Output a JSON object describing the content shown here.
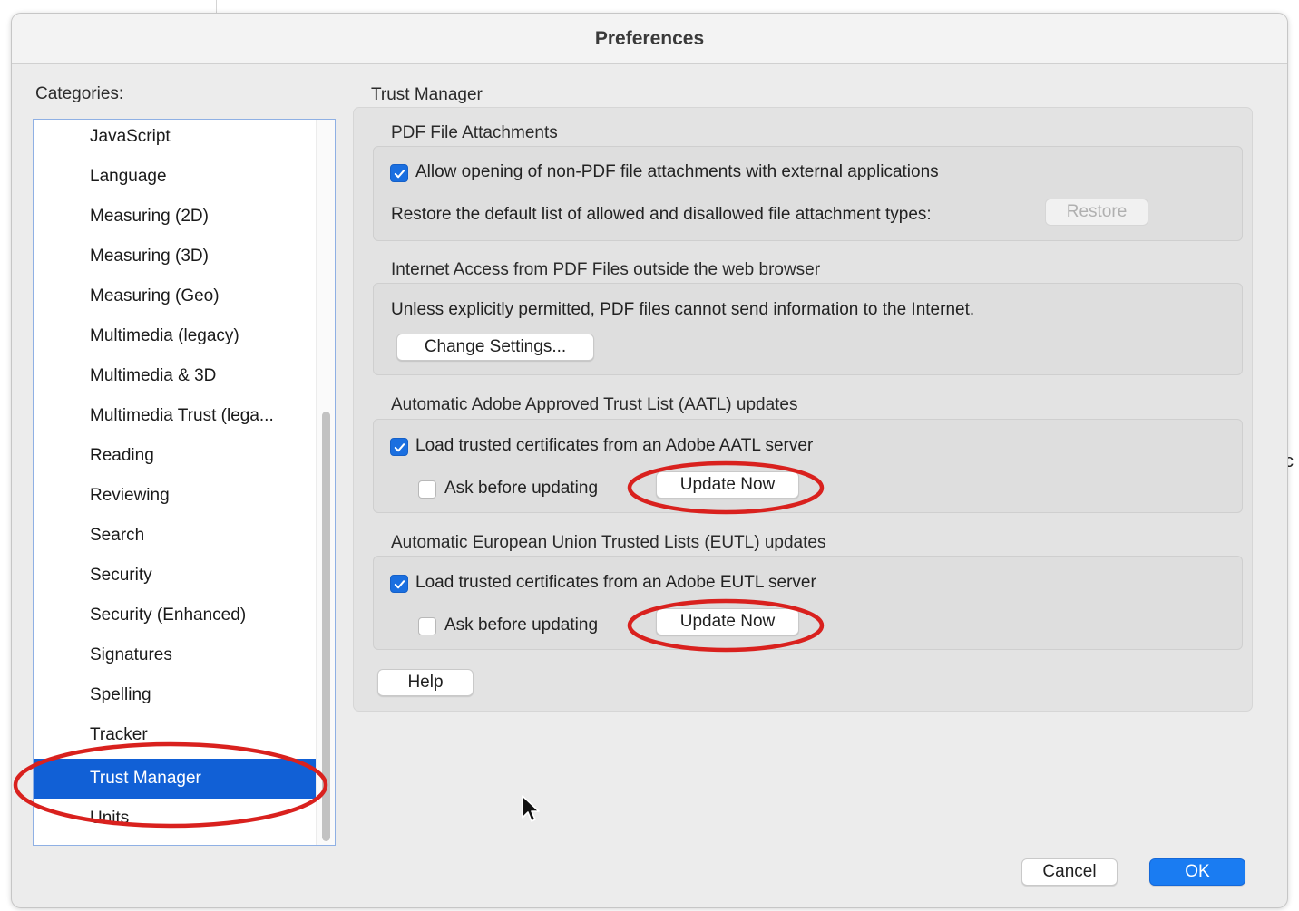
{
  "dialog": {
    "title": "Preferences"
  },
  "categories": {
    "label": "Categories:",
    "items": [
      {
        "label": "JavaScript"
      },
      {
        "label": "Language"
      },
      {
        "label": "Measuring (2D)"
      },
      {
        "label": "Measuring (3D)"
      },
      {
        "label": "Measuring (Geo)"
      },
      {
        "label": "Multimedia (legacy)"
      },
      {
        "label": "Multimedia & 3D"
      },
      {
        "label": "Multimedia Trust (lega..."
      },
      {
        "label": "Reading"
      },
      {
        "label": "Reviewing"
      },
      {
        "label": "Search"
      },
      {
        "label": "Security"
      },
      {
        "label": "Security (Enhanced)"
      },
      {
        "label": "Signatures"
      },
      {
        "label": "Spelling"
      },
      {
        "label": "Tracker"
      },
      {
        "label": "Trust Manager",
        "selected": true
      },
      {
        "label": "Units"
      }
    ]
  },
  "panel": {
    "title": "Trust Manager",
    "attachments": {
      "title": "PDF File Attachments",
      "allow_label": "Allow opening of non-PDF file attachments with external applications",
      "allow_checked": true,
      "restore_text": "Restore the default list of allowed and disallowed file attachment types:",
      "restore_label": "Restore"
    },
    "internet": {
      "title": "Internet Access from PDF Files outside the web browser",
      "description": "Unless explicitly permitted, PDF files cannot send information to the Internet.",
      "change_label": "Change Settings..."
    },
    "aatl": {
      "title": "Automatic Adobe Approved Trust List (AATL) updates",
      "load_label": "Load trusted certificates from an Adobe AATL server",
      "load_checked": true,
      "ask_label": "Ask before updating",
      "ask_checked": false,
      "update_label": "Update Now"
    },
    "eutl": {
      "title": "Automatic European Union Trusted Lists (EUTL) updates",
      "load_label": "Load trusted certificates from an Adobe EUTL server",
      "load_checked": true,
      "ask_label": "Ask before updating",
      "ask_checked": false,
      "update_label": "Update Now"
    },
    "help_label": "Help"
  },
  "footer": {
    "cancel_label": "Cancel",
    "ok_label": "OK"
  },
  "colors": {
    "accent": "#1160d6",
    "annotation": "#d9211e",
    "check": "#1a6fe0"
  },
  "stray_text": "c"
}
